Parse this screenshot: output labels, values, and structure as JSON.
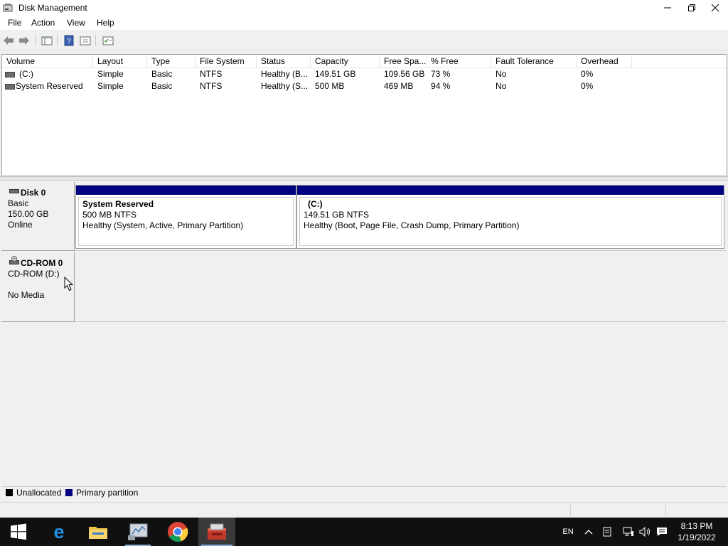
{
  "window": {
    "title": "Disk Management",
    "controls": [
      "minimize",
      "restore",
      "close"
    ]
  },
  "menu": {
    "items": [
      "File",
      "Action",
      "View",
      "Help"
    ]
  },
  "toolbar": {
    "buttons": [
      "back-icon",
      "forward-icon",
      "console-tree-icon",
      "help-icon",
      "properties-icon",
      "settings-icon"
    ]
  },
  "volume_list": {
    "columns": [
      "Volume",
      "Layout",
      "Type",
      "File System",
      "Status",
      "Capacity",
      "Free Spa...",
      "% Free",
      "Fault Tolerance",
      "Overhead"
    ],
    "rows": [
      [
        "(C:)",
        "Simple",
        "Basic",
        "NTFS",
        "Healthy (B...",
        "149.51 GB",
        "109.56 GB",
        "73 %",
        "No",
        "0%"
      ],
      [
        "System Reserved",
        "Simple",
        "Basic",
        "NTFS",
        "Healthy (S...",
        "500 MB",
        "469 MB",
        "94 %",
        "No",
        "0%"
      ]
    ]
  },
  "disks": [
    {
      "name": "Disk 0",
      "type": "Basic",
      "size": "150.00 GB",
      "state": "Online",
      "partitions": [
        {
          "name": "System Reserved",
          "size_fs": "500 MB NTFS",
          "status": "Healthy (System, Active, Primary Partition)"
        },
        {
          "name": "(C:)",
          "size_fs": "149.51 GB NTFS",
          "status": "Healthy (Boot, Page File, Crash Dump, Primary Partition)"
        }
      ]
    },
    {
      "name": "CD-ROM 0",
      "type": "CD-ROM (D:)",
      "size": "",
      "state": "No Media"
    }
  ],
  "legend": {
    "items": [
      {
        "label": "Unallocated",
        "color": "#000000"
      },
      {
        "label": "Primary partition",
        "color": "#000080"
      }
    ]
  },
  "taskbar": {
    "apps": [
      "start-icon",
      "edge-icon",
      "file-explorer-icon",
      "server-manager-icon",
      "chrome-icon",
      "disk-management-icon"
    ],
    "language": "EN",
    "time": "8:13 PM",
    "date": "1/19/2022"
  }
}
